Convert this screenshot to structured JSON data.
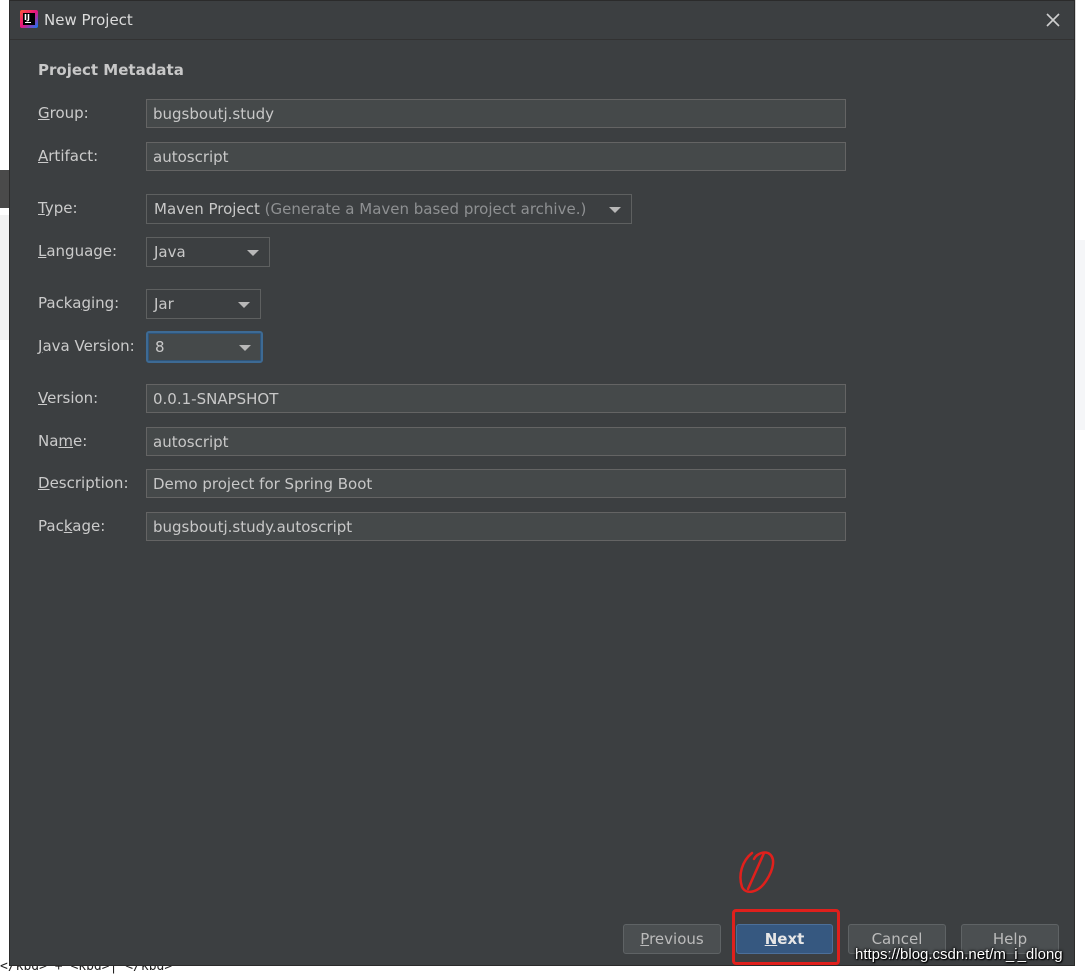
{
  "window": {
    "title": "New Project",
    "icon": "intellij-idea-icon"
  },
  "section_title": "Project Metadata",
  "fields": {
    "group": {
      "label_pre": "",
      "label_mnemonic": "G",
      "label_post": "roup:",
      "value": "bugsboutj.study"
    },
    "artifact": {
      "label_pre": "",
      "label_mnemonic": "A",
      "label_post": "rtifact:",
      "value": "autoscript"
    },
    "type": {
      "label_pre": "",
      "label_mnemonic": "T",
      "label_post": "ype:",
      "value": "Maven Project",
      "hint": "(Generate a Maven based project archive.)"
    },
    "language": {
      "label_pre": "",
      "label_mnemonic": "L",
      "label_post": "anguage:",
      "value": "Java"
    },
    "packaging": {
      "label_pre": "Packa",
      "label_mnemonic": "g",
      "label_post": "ing:",
      "value": "Jar"
    },
    "java_version": {
      "label_pre": "",
      "label_mnemonic": "J",
      "label_post": "ava Version:",
      "value": "8"
    },
    "version": {
      "label_pre": "",
      "label_mnemonic": "V",
      "label_post": "ersion:",
      "value": "0.0.1-SNAPSHOT"
    },
    "name": {
      "label_pre": "Na",
      "label_mnemonic": "m",
      "label_post": "e:",
      "value": "autoscript"
    },
    "description": {
      "label_pre": "",
      "label_mnemonic": "D",
      "label_post": "escription:",
      "value": "Demo project for Spring Boot"
    },
    "package": {
      "label_pre": "Pac",
      "label_mnemonic": "k",
      "label_post": "age:",
      "value": "bugsboutj.study.autoscript"
    }
  },
  "buttons": {
    "previous": {
      "mnemonic": "P",
      "rest": "revious"
    },
    "next": {
      "mnemonic": "N",
      "rest": "ext"
    },
    "cancel": "Cancel",
    "help": "Help"
  },
  "annotation": {
    "step_mark": "①",
    "color": "#e0201c"
  },
  "watermark": "https://blog.csdn.net/m_i_dlong",
  "background_page": {
    "kbd_text": "</kbd> + <kbd>| </kbd>"
  },
  "colors": {
    "dialog_bg": "#3c3f41",
    "field_bg": "#45494a",
    "primary_button": "#365880",
    "focus_ring": "#3d6a94"
  }
}
